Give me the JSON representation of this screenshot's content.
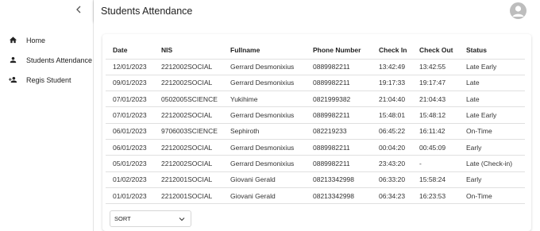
{
  "sidebar": {
    "items": [
      {
        "label": "Home",
        "icon": "home-icon"
      },
      {
        "label": "Students Attendance",
        "icon": "person-icon"
      },
      {
        "label": "Regis Student",
        "icon": "person-add-icon"
      }
    ]
  },
  "header": {
    "title": "Students Attendance"
  },
  "table": {
    "headers": [
      "Date",
      "NIS",
      "Fullname",
      "Phone Number",
      "Check In",
      "Check Out",
      "Status"
    ],
    "rows": [
      [
        "12/01/2023",
        "2212002SOCIAL",
        "Gerrard Desmonixius",
        "0889982211",
        "13:42:49",
        "13:42:55",
        "Late Early"
      ],
      [
        "09/01/2023",
        "2212002SOCIAL",
        "Gerrard Desmonixius",
        "0889982211",
        "19:17:33",
        "19:17:47",
        "Late"
      ],
      [
        "07/01/2023",
        "0502005SCIENCE",
        "Yukihime",
        "0821999382",
        "21:04:40",
        "21:04:43",
        "Late"
      ],
      [
        "07/01/2023",
        "2212002SOCIAL",
        "Gerrard Desmonixius",
        "0889982211",
        "15:48:01",
        "15:48:12",
        "Late Early"
      ],
      [
        "06/01/2023",
        "9706003SCIENCE",
        "Sephiroth",
        "082219233",
        "06:45:22",
        "16:11:42",
        "On-Time"
      ],
      [
        "06/01/2023",
        "2212002SOCIAL",
        "Gerrard Desmonixius",
        "0889982211",
        "00:04:20",
        "00:45:09",
        "Early"
      ],
      [
        "05/01/2023",
        "2212002SOCIAL",
        "Gerrard Desmonixius",
        "0889982211",
        "23:43:20",
        "-",
        "Late (Check-in)"
      ],
      [
        "01/02/2023",
        "2212001SOCIAL",
        "Giovani Gerald",
        "08213342998",
        "06:33:20",
        "15:58:24",
        "Early"
      ],
      [
        "01/01/2023",
        "2212001SOCIAL",
        "Giovani Gerald",
        "08213342998",
        "06:34:23",
        "16:23:53",
        "On-Time"
      ]
    ]
  },
  "sort": {
    "label": "SORT"
  },
  "colors": {
    "accent": "#bdbdbd",
    "border": "#e0e0e0"
  }
}
